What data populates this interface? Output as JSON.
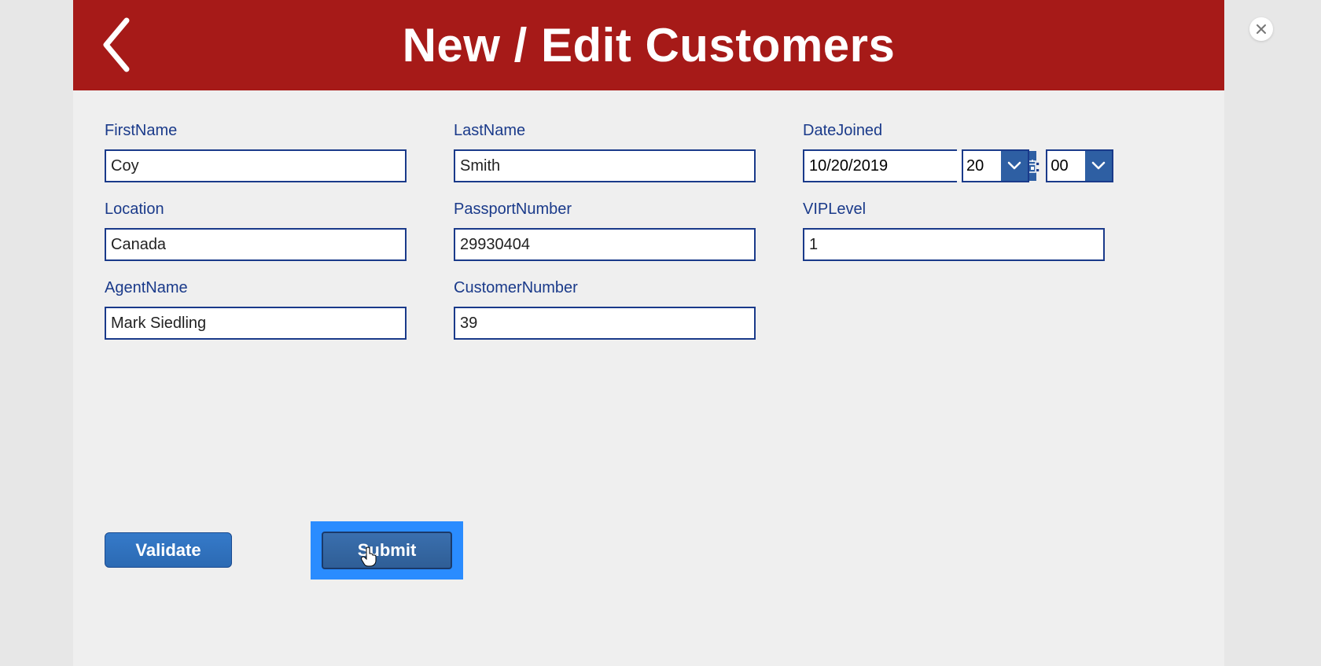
{
  "header": {
    "title": "New / Edit Customers"
  },
  "fields": {
    "firstName": {
      "label": "FirstName",
      "value": "Coy"
    },
    "lastName": {
      "label": "LastName",
      "value": "Smith"
    },
    "dateJoined": {
      "label": "DateJoined",
      "date": "10/20/2019",
      "hour": "20",
      "minute": "00",
      "separator": ":"
    },
    "location": {
      "label": "Location",
      "value": "Canada"
    },
    "passportNumber": {
      "label": "PassportNumber",
      "value": "29930404"
    },
    "vipLevel": {
      "label": "VIPLevel",
      "value": "1"
    },
    "agentName": {
      "label": "AgentName",
      "value": "Mark Siedling"
    },
    "customerNumber": {
      "label": "CustomerNumber",
      "value": "39"
    }
  },
  "buttons": {
    "validate": "Validate",
    "submit": "Submit"
  }
}
